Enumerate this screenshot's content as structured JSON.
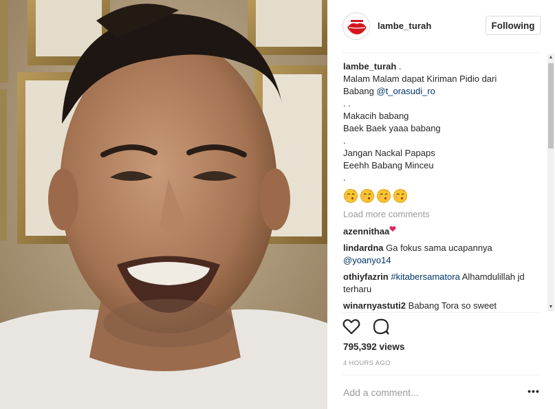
{
  "post": {
    "username": "lambe_turah",
    "follow_label": "Following",
    "caption_user": "lambe_turah",
    "caption_lines": [
      " .",
      "Malam Malam dapat Kiriman Pidio dari",
      "Babang ",
      ". .",
      "Makacih babang",
      "Baek Baek yaaa babang",
      ".",
      "",
      "Jangan Nackal Papaps",
      "Eeehh Babang Minceu",
      "."
    ],
    "caption_mention": "@t_orasudi_ro",
    "emojis": [
      "kissing-face-icon",
      "kissing-face-icon",
      "kissing-face-icon",
      "kissing-face-icon"
    ],
    "load_more": "Load more comments",
    "comments": [
      {
        "user": "azennithaa",
        "text": "",
        "icon": "heart-icon"
      },
      {
        "user": "lindardna",
        "text": " Ga fokus sama ucapannya",
        "mention": "@yoanyo14"
      },
      {
        "user": "othiyfazrin",
        "tag": "#kitabersamatora",
        "text": " Alhamdulillah jd terharu"
      },
      {
        "user": "winarnyastuti2",
        "text": " Babang Tora so sweet"
      }
    ],
    "views": "795,392 views",
    "time": "4 HOURS AGO",
    "add_comment_placeholder": "Add a comment...",
    "more_label": "•••"
  },
  "colors": {
    "link": "#003569",
    "muted": "#999999",
    "text": "#262626",
    "border": "#dbdbdb"
  }
}
